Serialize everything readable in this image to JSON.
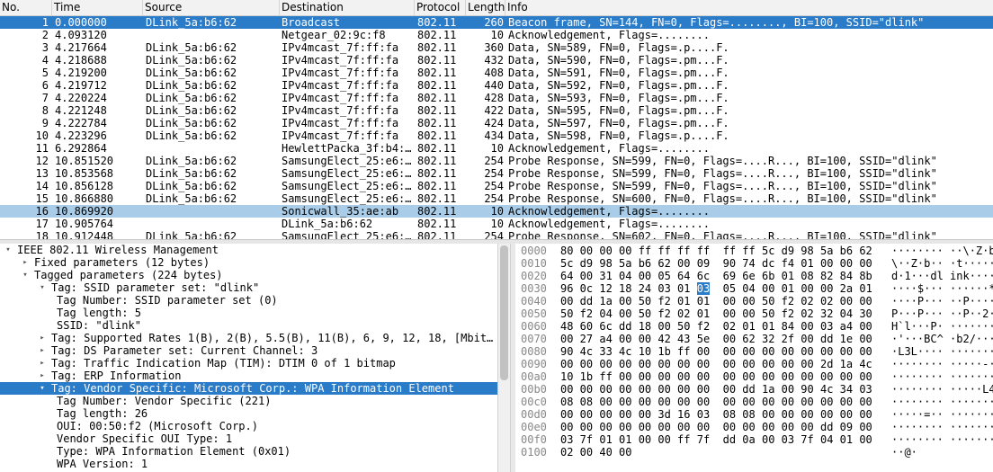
{
  "columns": {
    "no": "No.",
    "time": "Time",
    "source": "Source",
    "destination": "Destination",
    "protocol": "Protocol",
    "length": "Length",
    "info": "Info"
  },
  "packets": [
    {
      "no": "1",
      "time": "0.000000",
      "source": "DLink_5a:b6:62",
      "destination": "Broadcast",
      "protocol": "802.11",
      "length": "260",
      "info": "Beacon frame, SN=144, FN=0, Flags=........, BI=100, SSID=\"dlink\""
    },
    {
      "no": "2",
      "time": "4.093120",
      "source": "",
      "destination": "Netgear_02:9c:f8",
      "protocol": "802.11",
      "length": "10",
      "info": "Acknowledgement, Flags=........"
    },
    {
      "no": "3",
      "time": "4.217664",
      "source": "DLink_5a:b6:62",
      "destination": "IPv4mcast_7f:ff:fa",
      "protocol": "802.11",
      "length": "360",
      "info": "Data, SN=589, FN=0, Flags=.p....F."
    },
    {
      "no": "4",
      "time": "4.218688",
      "source": "DLink_5a:b6:62",
      "destination": "IPv4mcast_7f:ff:fa",
      "protocol": "802.11",
      "length": "432",
      "info": "Data, SN=590, FN=0, Flags=.pm...F."
    },
    {
      "no": "5",
      "time": "4.219200",
      "source": "DLink_5a:b6:62",
      "destination": "IPv4mcast_7f:ff:fa",
      "protocol": "802.11",
      "length": "408",
      "info": "Data, SN=591, FN=0, Flags=.pm...F."
    },
    {
      "no": "6",
      "time": "4.219712",
      "source": "DLink_5a:b6:62",
      "destination": "IPv4mcast_7f:ff:fa",
      "protocol": "802.11",
      "length": "440",
      "info": "Data, SN=592, FN=0, Flags=.pm...F."
    },
    {
      "no": "7",
      "time": "4.220224",
      "source": "DLink_5a:b6:62",
      "destination": "IPv4mcast_7f:ff:fa",
      "protocol": "802.11",
      "length": "428",
      "info": "Data, SN=593, FN=0, Flags=.pm...F."
    },
    {
      "no": "8",
      "time": "4.221248",
      "source": "DLink_5a:b6:62",
      "destination": "IPv4mcast_7f:ff:fa",
      "protocol": "802.11",
      "length": "422",
      "info": "Data, SN=595, FN=0, Flags=.pm...F."
    },
    {
      "no": "9",
      "time": "4.222784",
      "source": "DLink_5a:b6:62",
      "destination": "IPv4mcast_7f:ff:fa",
      "protocol": "802.11",
      "length": "424",
      "info": "Data, SN=597, FN=0, Flags=.pm...F."
    },
    {
      "no": "10",
      "time": "4.223296",
      "source": "DLink_5a:b6:62",
      "destination": "IPv4mcast_7f:ff:fa",
      "protocol": "802.11",
      "length": "434",
      "info": "Data, SN=598, FN=0, Flags=.p....F."
    },
    {
      "no": "11",
      "time": "6.292864",
      "source": "",
      "destination": "HewlettPacka_3f:b4:…",
      "protocol": "802.11",
      "length": "10",
      "info": "Acknowledgement, Flags=........"
    },
    {
      "no": "12",
      "time": "10.851520",
      "source": "DLink_5a:b6:62",
      "destination": "SamsungElect_25:e6:…",
      "protocol": "802.11",
      "length": "254",
      "info": "Probe Response, SN=599, FN=0, Flags=....R..., BI=100, SSID=\"dlink\""
    },
    {
      "no": "13",
      "time": "10.853568",
      "source": "DLink_5a:b6:62",
      "destination": "SamsungElect_25:e6:…",
      "protocol": "802.11",
      "length": "254",
      "info": "Probe Response, SN=599, FN=0, Flags=....R..., BI=100, SSID=\"dlink\""
    },
    {
      "no": "14",
      "time": "10.856128",
      "source": "DLink_5a:b6:62",
      "destination": "SamsungElect_25:e6:…",
      "protocol": "802.11",
      "length": "254",
      "info": "Probe Response, SN=599, FN=0, Flags=....R..., BI=100, SSID=\"dlink\""
    },
    {
      "no": "15",
      "time": "10.866880",
      "source": "DLink_5a:b6:62",
      "destination": "SamsungElect_25:e6:…",
      "protocol": "802.11",
      "length": "254",
      "info": "Probe Response, SN=600, FN=0, Flags=....R..., BI=100, SSID=\"dlink\""
    },
    {
      "no": "16",
      "time": "10.869920",
      "source": "",
      "destination": "Sonicwall_35:ae:ab",
      "protocol": "802.11",
      "length": "10",
      "info": "Acknowledgement, Flags=........"
    },
    {
      "no": "17",
      "time": "10.905764",
      "source": "",
      "destination": "DLink_5a:b6:62",
      "protocol": "802.11",
      "length": "10",
      "info": "Acknowledgement, Flags=........"
    },
    {
      "no": "18",
      "time": "10.912448",
      "source": "DLink_5a:b6:62",
      "destination": "SamsungElect_25:e6:…",
      "protocol": "802.11",
      "length": "254",
      "info": "Probe Response, SN=602, FN=0, Flags=....R..., BI=100, SSID=\"dlink\""
    }
  ],
  "detail": [
    {
      "text": "IEEE 802.11 Wireless Management",
      "arrow": "open",
      "level": 0
    },
    {
      "text": "Fixed parameters (12 bytes)",
      "arrow": "closed",
      "level": 1
    },
    {
      "text": "Tagged parameters (224 bytes)",
      "arrow": "open",
      "level": 1
    },
    {
      "text": "Tag: SSID parameter set: \"dlink\"",
      "arrow": "open",
      "level": 2
    },
    {
      "text": "Tag Number: SSID parameter set (0)",
      "arrow": "none",
      "level": 3
    },
    {
      "text": "Tag length: 5",
      "arrow": "none",
      "level": 3
    },
    {
      "text": "SSID: \"dlink\"",
      "arrow": "none",
      "level": 3
    },
    {
      "text": "Tag: Supported Rates 1(B), 2(B), 5.5(B), 11(B), 6, 9, 12, 18, [Mbit…",
      "arrow": "closed",
      "level": 2
    },
    {
      "text": "Tag: DS Parameter set: Current Channel: 3",
      "arrow": "closed",
      "level": 2
    },
    {
      "text": "Tag: Traffic Indication Map (TIM): DTIM 0 of 1 bitmap",
      "arrow": "closed",
      "level": 2
    },
    {
      "text": "Tag: ERP Information",
      "arrow": "closed",
      "level": 2
    },
    {
      "text": "Tag: Vendor Specific: Microsoft Corp.: WPA Information Element",
      "arrow": "open",
      "level": 2
    },
    {
      "text": "Tag Number: Vendor Specific (221)",
      "arrow": "none",
      "level": 3
    },
    {
      "text": "Tag length: 26",
      "arrow": "none",
      "level": 3
    },
    {
      "text": "OUI: 00:50:f2 (Microsoft Corp.)",
      "arrow": "none",
      "level": 3
    },
    {
      "text": "Vendor Specific OUI Type: 1",
      "arrow": "none",
      "level": 3
    },
    {
      "text": "Type: WPA Information Element (0x01)",
      "arrow": "none",
      "level": 3
    },
    {
      "text": "WPA Version: 1",
      "arrow": "none",
      "level": 3
    }
  ],
  "hex": [
    {
      "off": "0000",
      "bytes": "80 00 00 00 ff ff ff ff  ff ff 5c d9 98 5a b6 62",
      "ascii": "········ ··\\·Z·b"
    },
    {
      "off": "0010",
      "bytes": "5c d9 98 5a b6 62 00 09  90 74 dc f4 01 00 00 00",
      "ascii": "\\··Z·b·· ·t······"
    },
    {
      "off": "0020",
      "bytes": "64 00 31 04 00 05 64 6c  69 6e 6b 01 08 82 84 8b",
      "ascii": "d·1···dl ink·····"
    },
    {
      "off": "0030",
      "bytes": "96 0c 12 18 24 03 01 03  05 04 00 01 00 00 2a 01",
      "ascii": "····$··· ······*·",
      "hl": "03"
    },
    {
      "off": "0040",
      "bytes": "00 dd 1a 00 50 f2 01 01  00 00 50 f2 02 02 00 00",
      "ascii": "····P··· ··P·····"
    },
    {
      "off": "0050",
      "bytes": "50 f2 04 00 50 f2 02 01  00 00 50 f2 02 32 04 30",
      "ascii": "P···P··· ··P··2·0"
    },
    {
      "off": "0060",
      "bytes": "48 60 6c dd 18 00 50 f2  02 01 01 84 00 03 a4 00",
      "ascii": "H`l···P· ·········"
    },
    {
      "off": "0070",
      "bytes": "00 27 a4 00 00 42 43 5e  00 62 32 2f 00 dd 1e 00",
      "ascii": "·'···BC^ ·b2/····"
    },
    {
      "off": "0080",
      "bytes": "90 4c 33 4c 10 1b ff 00  00 00 00 00 00 00 00 00",
      "ascii": "·L3L···· ········"
    },
    {
      "off": "0090",
      "bytes": "00 00 00 00 00 00 00 00  00 00 00 00 00 2d 1a 4c",
      "ascii": "········ ·····-·L"
    },
    {
      "off": "00a0",
      "bytes": "10 1b ff 00 00 00 00 00  00 00 00 00 00 00 00 00",
      "ascii": "········ ········"
    },
    {
      "off": "00b0",
      "bytes": "00 00 00 00 00 00 00 00  00 dd 1a 00 90 4c 34 03",
      "ascii": "········ ·····L4·"
    },
    {
      "off": "00c0",
      "bytes": "08 08 00 00 00 00 00 00  00 00 00 00 00 00 00 00",
      "ascii": "········ ········"
    },
    {
      "off": "00d0",
      "bytes": "00 00 00 00 00 3d 16 03  08 08 00 00 00 00 00 00",
      "ascii": "·····=·· ········"
    },
    {
      "off": "00e0",
      "bytes": "00 00 00 00 00 00 00 00  00 00 00 00 00 dd 09 00",
      "ascii": "········ ········"
    },
    {
      "off": "00f0",
      "bytes": "03 7f 01 01 00 00 ff 7f  dd 0a 00 03 7f 04 01 00",
      "ascii": "········ ········"
    },
    {
      "off": "0100",
      "bytes": "02 00 40 00",
      "ascii": "··@·"
    }
  ],
  "colors": {
    "selected": "#2a7bc8",
    "highlight": "#a9cde8"
  }
}
